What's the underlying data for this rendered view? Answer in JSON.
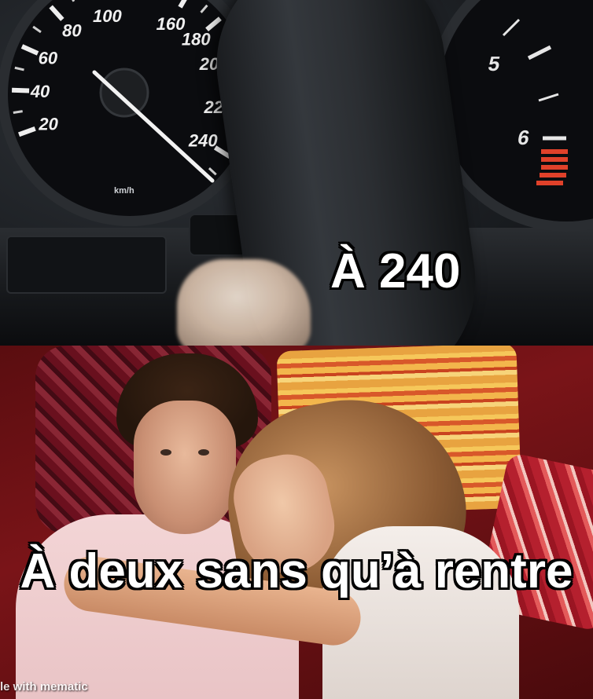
{
  "top_panel": {
    "caption": "À 240",
    "speedometer": {
      "unit": "km/h",
      "tick_labels": [
        "20",
        "40",
        "60",
        "80",
        "100",
        "160",
        "180",
        "200",
        "220",
        "240"
      ],
      "needle_value": 240
    },
    "rpm_gauge": {
      "tick_labels": [
        "5",
        "6"
      ]
    }
  },
  "bottom_panel": {
    "caption": "À deux sans qu’à rentre"
  },
  "watermark": "le with mematic",
  "colors": {
    "caption_fill": "#ffffff",
    "caption_outline": "#000000",
    "gauge_face": "#0b0c0f",
    "redline": "#e0412a"
  }
}
